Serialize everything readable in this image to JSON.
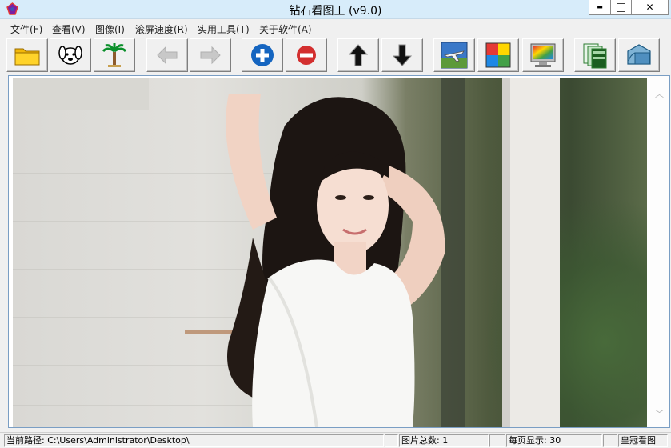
{
  "window": {
    "title": "钻石看图王 (v9.0)",
    "minimize_glyph": "▬",
    "maximize_glyph": "□",
    "close_glyph": "✕"
  },
  "menu": [
    "文件(F)",
    "查看(V)",
    "图像(I)",
    "滚屏速度(R)",
    "实用工具(T)",
    "关于软件(A)"
  ],
  "toolbar": [
    {
      "icon": "folder-icon",
      "enabled": true
    },
    {
      "icon": "dog-icon",
      "enabled": true
    },
    {
      "icon": "palm-tree-icon",
      "enabled": true
    },
    {
      "icon": "arrow-left-icon",
      "enabled": false
    },
    {
      "icon": "arrow-right-icon",
      "enabled": false
    },
    {
      "icon": "zoom-in-icon",
      "enabled": true
    },
    {
      "icon": "zoom-out-icon",
      "enabled": true
    },
    {
      "icon": "arrow-up-icon",
      "enabled": true
    },
    {
      "icon": "arrow-down-icon",
      "enabled": true
    },
    {
      "icon": "airplane-icon",
      "enabled": true
    },
    {
      "icon": "color-grid-icon",
      "enabled": true
    },
    {
      "icon": "monitor-icon",
      "enabled": true
    },
    {
      "icon": "cards-icon",
      "enabled": true
    },
    {
      "icon": "open-box-icon",
      "enabled": true
    }
  ],
  "colors": {
    "titlebar": "#d7ecfa",
    "zoom_in": "#1565c0",
    "zoom_out": "#d32f2f"
  },
  "image": {
    "description_icon": "photo-image"
  },
  "status": {
    "path_label": "当前路径:",
    "path_value": "C:\\Users\\Administrator\\Desktop\\",
    "total_label": "图片总数:",
    "total_value": "1",
    "per_page_label": "每页显示:",
    "per_page_value": "30",
    "app_label": "皇冠看图"
  }
}
